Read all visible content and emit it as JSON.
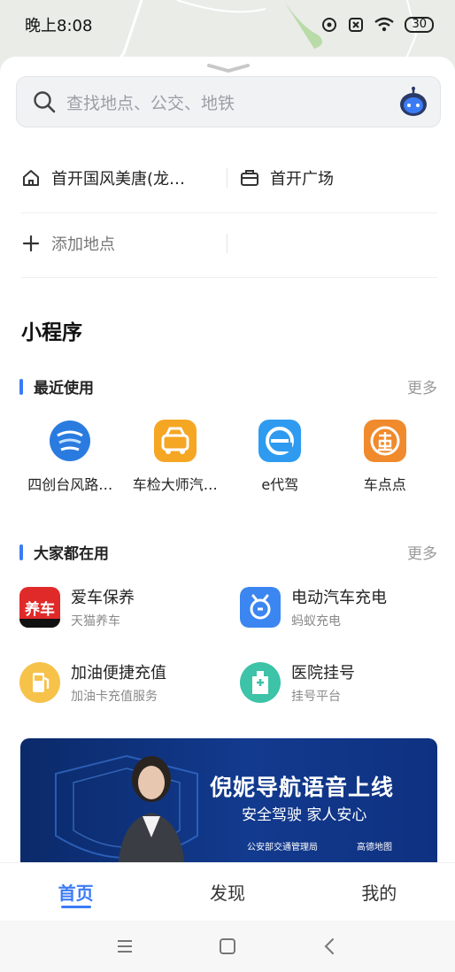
{
  "status_bar": {
    "time": "晚上8:08",
    "battery": "30"
  },
  "search": {
    "placeholder": "查找地点、公交、地铁"
  },
  "quick_places": {
    "home_label": "首开国风美唐(龙…",
    "work_label": "首开广场",
    "add_label": "添加地点"
  },
  "mini_programs": {
    "title": "小程序",
    "recent": {
      "title": "最近使用",
      "more": "更多",
      "apps": [
        {
          "name": "四创台风路…",
          "icon": "typhoon-icon",
          "color": "#2a7be0"
        },
        {
          "name": "车检大师汽…",
          "icon": "car-inspection-icon",
          "color": "#f5a623"
        },
        {
          "name": "e代驾",
          "icon": "e-driver-icon",
          "color": "#2e9bf0"
        },
        {
          "name": "车点点",
          "icon": "car-dot-icon",
          "color": "#f08a2c"
        }
      ]
    },
    "popular": {
      "title": "大家都在用",
      "more": "更多",
      "items": [
        {
          "title": "爱车保养",
          "subtitle": "天猫养车",
          "icon": "car-care-icon",
          "icon_text": "养车",
          "color": "#e02a2a"
        },
        {
          "title": "电动汽车充电",
          "subtitle": "蚂蚁充电",
          "icon": "ev-charging-icon",
          "color": "#3b86f0"
        },
        {
          "title": "加油便捷充值",
          "subtitle": "加油卡充值服务",
          "icon": "fuel-icon",
          "color": "#f6c24a"
        },
        {
          "title": "医院挂号",
          "subtitle": "挂号平台",
          "icon": "hospital-icon",
          "color": "#3cc3a8"
        }
      ]
    }
  },
  "banner": {
    "headline": "倪妮导航语音上线",
    "subline": "安全驾驶 家人安心",
    "credit_left": "公安部交通管理局",
    "credit_right": "高德地图"
  },
  "tabs": [
    {
      "label": "首页",
      "active": true
    },
    {
      "label": "发现",
      "active": false
    },
    {
      "label": "我的",
      "active": false
    }
  ]
}
